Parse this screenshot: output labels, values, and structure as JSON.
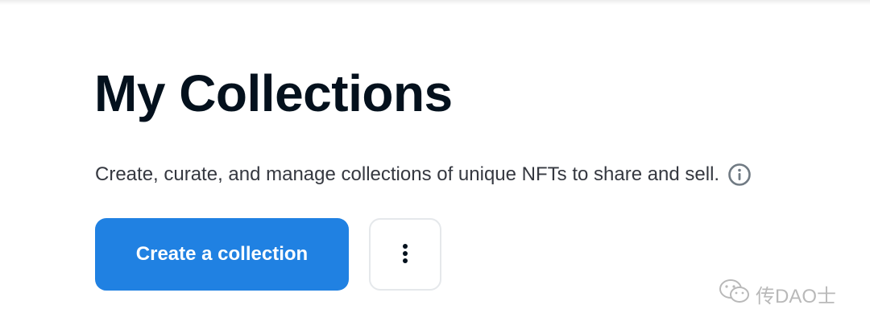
{
  "header": {
    "title": "My Collections",
    "description": "Create, curate, and manage collections of unique NFTs to share and sell."
  },
  "actions": {
    "create_label": "Create a collection",
    "more_icon": "more-vertical-icon"
  },
  "icons": {
    "info": "info-circle-icon"
  },
  "watermark": {
    "text": "传DAO士",
    "icon": "wechat-icon"
  },
  "colors": {
    "primary": "#2081e2",
    "title": "#04111d",
    "text": "#353840",
    "border": "#e5e8eb"
  }
}
